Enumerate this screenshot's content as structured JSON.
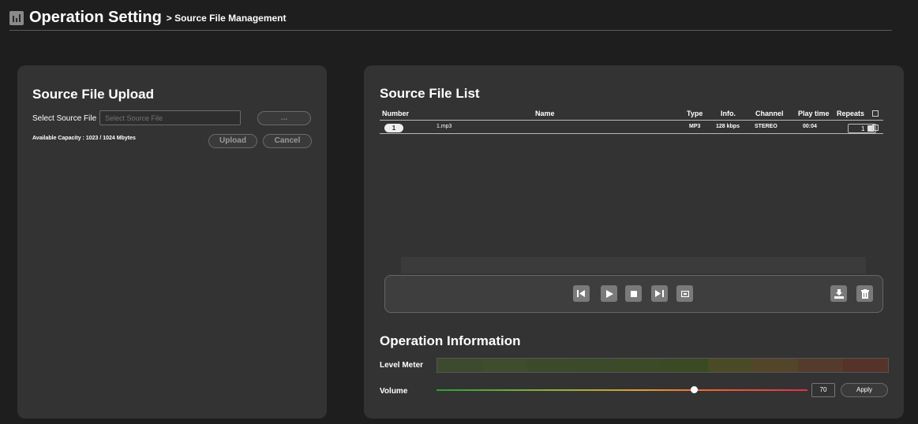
{
  "header": {
    "title": "Operation Setting",
    "breadcrumb": "> Source File Management",
    "icon": "chart-bar-icon"
  },
  "upload": {
    "title": "Source File Upload",
    "select_label": "Select Source File",
    "select_placeholder": "Select Source File",
    "browse_label": "...",
    "capacity": "Available Capacity : 1023 / 1024 Mbytes",
    "upload_label": "Upload",
    "cancel_label": "Cancel"
  },
  "file_list": {
    "title": "Source File List",
    "columns": [
      "Number",
      "Name",
      "Type",
      "Info.",
      "Channel",
      "Play time",
      "Repeats"
    ],
    "rows": [
      {
        "number": "1",
        "name": "1.mp3",
        "type": "MP3",
        "info": "128 kbps",
        "channel": "STEREO",
        "play_time": "00:04",
        "repeats": "1"
      }
    ]
  },
  "player": {
    "buttons": [
      "previous-icon",
      "play-icon",
      "stop-icon",
      "next-icon",
      "repeat-icon",
      "download-icon",
      "trash-icon"
    ]
  },
  "operation": {
    "title": "Operation Information",
    "level_meter_label": "Level Meter",
    "volume_label": "Volume",
    "volume_value": "70",
    "volume_level": 0.7,
    "apply_label": "Apply"
  },
  "colors": {
    "background": "#1e1e1e",
    "panel": "#333333",
    "meter_segments": [
      "#3d4a2e",
      "#3f4c2d",
      "#3b4a2b",
      "#3a4a2a",
      "#3c4a28",
      "#3a4a25",
      "#4a4a26",
      "#52452a",
      "#553b2c",
      "#553329"
    ]
  }
}
